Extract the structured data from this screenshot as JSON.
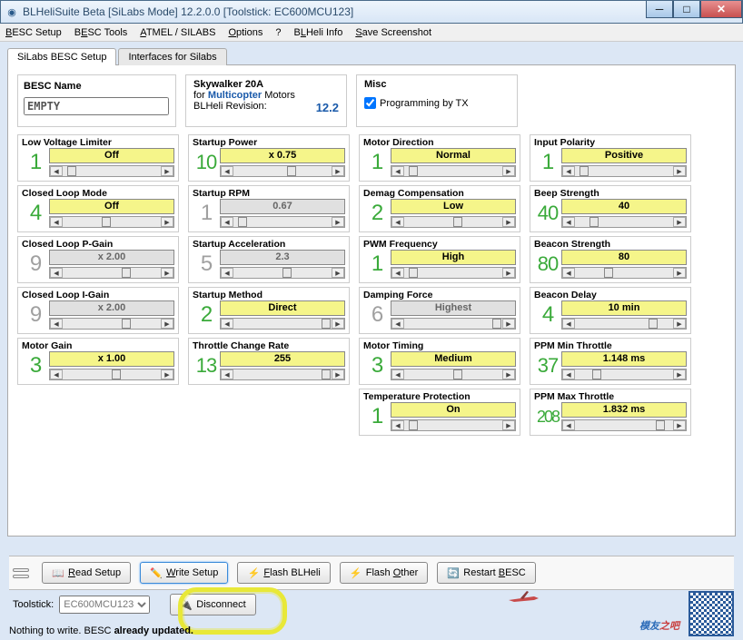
{
  "window": {
    "title": "BLHeliSuite Beta [SiLabs Mode] 12.2.0.0 [Toolstick: EC600MCU123]"
  },
  "menu": {
    "besc_setup": "BESC Setup",
    "besc_tools": "BESC Tools",
    "atmel": "ATMEL / SILABS",
    "options": "Options",
    "help": "?",
    "info": "BLHeli Info",
    "save": "Save Screenshot"
  },
  "tabs": {
    "t1": "SiLabs BESC Setup",
    "t2": "Interfaces for Silabs"
  },
  "besc": {
    "name_label": "BESC Name",
    "name_value": "EMPTY"
  },
  "info": {
    "l1": "Skywalker 20A",
    "for": "for ",
    "multi": "Multicopter",
    "motors": " Motors",
    "rev_lbl": "BLHeli Revision:",
    "rev": "12.2"
  },
  "misc": {
    "title": "Misc",
    "prog": "Programming by TX"
  },
  "p": {
    "lvl": {
      "lbl": "Low Voltage Limiter",
      "n": "1",
      "v": "Off",
      "g": true,
      "t": 5
    },
    "clm": {
      "lbl": "Closed Loop Mode",
      "n": "4",
      "v": "Off",
      "g": true,
      "t": 40
    },
    "clp": {
      "lbl": "Closed Loop P-Gain",
      "n": "9",
      "v": "x 2.00",
      "g": false,
      "t": 60
    },
    "cli": {
      "lbl": "Closed Loop I-Gain",
      "n": "9",
      "v": "x 2.00",
      "g": false,
      "t": 60
    },
    "mg": {
      "lbl": "Motor Gain",
      "n": "3",
      "v": "x 1.00",
      "g": true,
      "t": 50
    },
    "sp": {
      "lbl": "Startup Power",
      "n": "10",
      "v": "x 0.75",
      "g": true,
      "t": 55
    },
    "sr": {
      "lbl": "Startup RPM",
      "n": "1",
      "v": "0.67",
      "g": false,
      "t": 5
    },
    "sa": {
      "lbl": "Startup Acceleration",
      "n": "5",
      "v": "2.3",
      "g": false,
      "t": 50
    },
    "sm": {
      "lbl": "Startup Method",
      "n": "2",
      "v": "Direct",
      "g": true,
      "t": 90
    },
    "tcr": {
      "lbl": "Throttle Change  Rate",
      "n": "13",
      "v": "255",
      "g": true,
      "t": 90
    },
    "md": {
      "lbl": "Motor Direction",
      "n": "1",
      "v": "Normal",
      "g": true,
      "t": 5
    },
    "dc": {
      "lbl": "Demag Compensation",
      "n": "2",
      "v": "Low",
      "g": true,
      "t": 50
    },
    "pf": {
      "lbl": "PWM Frequency",
      "n": "1",
      "v": "High",
      "g": true,
      "t": 5
    },
    "df": {
      "lbl": "Damping Force",
      "n": "6",
      "v": "Highest",
      "g": false,
      "t": 90
    },
    "mt": {
      "lbl": "Motor Timing",
      "n": "3",
      "v": "Medium",
      "g": true,
      "t": 50
    },
    "tp": {
      "lbl": "Temperature Protection",
      "n": "1",
      "v": "On",
      "g": true,
      "t": 5
    },
    "ip": {
      "lbl": "Input Polarity",
      "n": "1",
      "v": "Positive",
      "g": true,
      "t": 5
    },
    "bs": {
      "lbl": "Beep Strength",
      "n": "40",
      "v": "40",
      "g": true,
      "t": 15
    },
    "bcs": {
      "lbl": "Beacon Strength",
      "n": "80",
      "v": "80",
      "g": true,
      "t": 30
    },
    "bd": {
      "lbl": "Beacon Delay",
      "n": "4",
      "v": "10 min",
      "g": true,
      "t": 75
    },
    "pmn": {
      "lbl": "PPM Min Throttle",
      "n": "37",
      "v": "1.148 ms",
      "g": true,
      "t": 18
    },
    "pmx": {
      "lbl": "PPM Max Throttle",
      "n": "208",
      "v": "1.832 ms",
      "g": true,
      "t": 82
    }
  },
  "buttons": {
    "read": "Read Setup",
    "write": "Write Setup",
    "flash": "Flash BLHeli",
    "other": "Flash Other",
    "restart": "Restart BESC",
    "disconnect": "Disconnect"
  },
  "bottom": {
    "tool_lbl": "Toolstick:",
    "tool": "EC600MCU123"
  },
  "status": {
    "p1": "Nothing to write. BESC ",
    "p2": "already updated."
  },
  "wm": {
    "t1": "模友",
    "t2": "之吧"
  }
}
